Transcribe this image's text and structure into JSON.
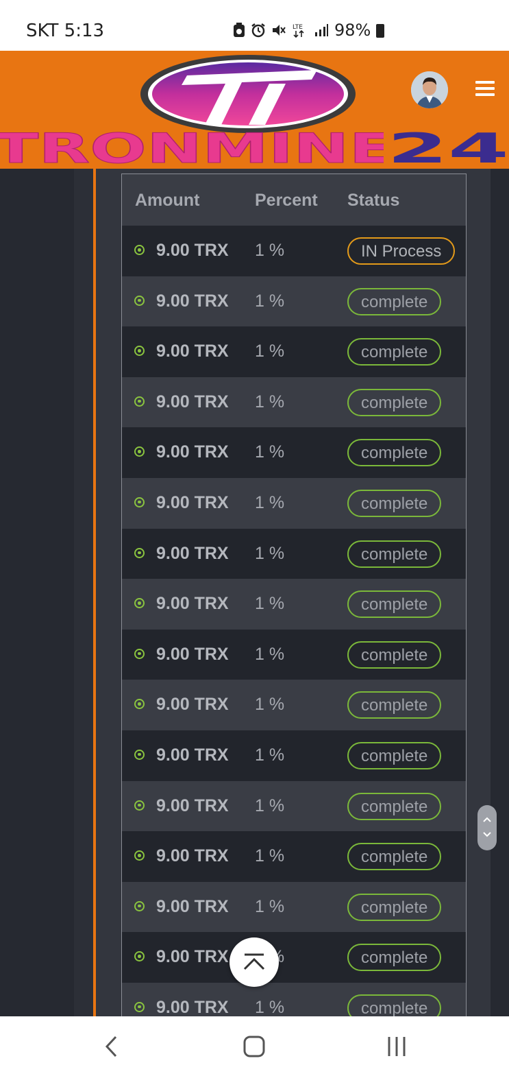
{
  "status_bar": {
    "carrier_time": "SKT 5:13",
    "battery_text": "98%",
    "icons": [
      "camera-badge-icon",
      "alarm-icon",
      "mute-icon",
      "lte-icon",
      "signal-icon",
      "battery-icon"
    ]
  },
  "header": {
    "brand_text": "TRONMINE 24",
    "logo": "tronmine-logo",
    "avatar": "user-avatar",
    "menu_icon": "hamburger-menu-icon",
    "colors": {
      "bar": "#e87512",
      "brand_pink": "#e83a8f",
      "brand_purple": "#3b2c8f"
    }
  },
  "table": {
    "headers": {
      "amount": "Amount",
      "percent": "Percent",
      "status": "Status"
    },
    "rows": [
      {
        "amount": "9.00 TRX",
        "percent": "1 %",
        "status": "IN Process"
      },
      {
        "amount": "9.00 TRX",
        "percent": "1 %",
        "status": "complete"
      },
      {
        "amount": "9.00 TRX",
        "percent": "1 %",
        "status": "complete"
      },
      {
        "amount": "9.00 TRX",
        "percent": "1 %",
        "status": "complete"
      },
      {
        "amount": "9.00 TRX",
        "percent": "1 %",
        "status": "complete"
      },
      {
        "amount": "9.00 TRX",
        "percent": "1 %",
        "status": "complete"
      },
      {
        "amount": "9.00 TRX",
        "percent": "1 %",
        "status": "complete"
      },
      {
        "amount": "9.00 TRX",
        "percent": "1 %",
        "status": "complete"
      },
      {
        "amount": "9.00 TRX",
        "percent": "1 %",
        "status": "complete"
      },
      {
        "amount": "9.00 TRX",
        "percent": "1 %",
        "status": "complete"
      },
      {
        "amount": "9.00 TRX",
        "percent": "1 %",
        "status": "complete"
      },
      {
        "amount": "9.00 TRX",
        "percent": "1 %",
        "status": "complete"
      },
      {
        "amount": "9.00 TRX",
        "percent": "1 %",
        "status": "complete"
      },
      {
        "amount": "9.00 TRX",
        "percent": "1 %",
        "status": "complete"
      },
      {
        "amount": "9.00 TRX",
        "percent": "1 %",
        "status": "complete"
      },
      {
        "amount": "9.00 TRX",
        "percent": "1 %",
        "status": "complete"
      }
    ],
    "colors": {
      "complete": "#7bb83a",
      "in_process": "#e39a1a",
      "row_icon": "#8ac43f"
    }
  },
  "controls": {
    "scroll_top_icon": "chevron-up-bar-icon",
    "scroll_handle_icons": [
      "chevron-up-icon",
      "chevron-down-icon"
    ]
  },
  "nav_bar": {
    "buttons": [
      "back-icon",
      "home-icon",
      "recents-icon"
    ]
  }
}
